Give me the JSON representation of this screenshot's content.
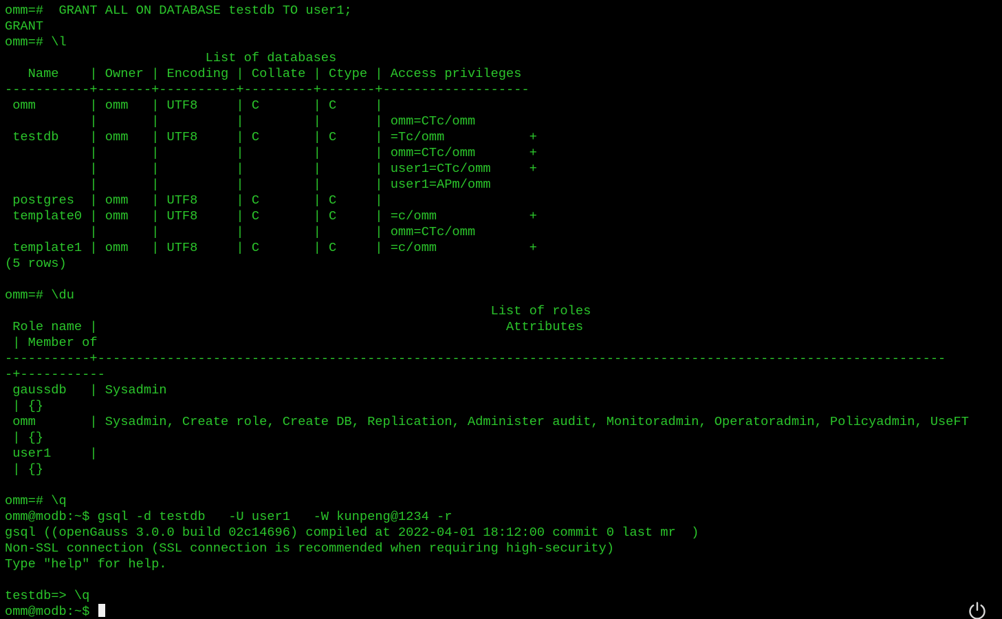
{
  "terminal": {
    "lines": [
      "omm=#  GRANT ALL ON DATABASE testdb TO user1;",
      "GRANT",
      "omm=# \\l",
      "                          List of databases",
      "   Name    | Owner | Encoding | Collate | Ctype | Access privileges",
      "-----------+-------+----------+---------+-------+-------------------",
      " omm       | omm   | UTF8     | C       | C     |",
      "           |       |          |         |       | omm=CTc/omm",
      " testdb    | omm   | UTF8     | C       | C     | =Tc/omm           +",
      "           |       |          |         |       | omm=CTc/omm       +",
      "           |       |          |         |       | user1=CTc/omm     +",
      "           |       |          |         |       | user1=APm/omm",
      " postgres  | omm   | UTF8     | C       | C     |",
      " template0 | omm   | UTF8     | C       | C     | =c/omm            +",
      "           |       |          |         |       | omm=CTc/omm",
      " template1 | omm   | UTF8     | C       | C     | =c/omm            +",
      "(5 rows)",
      "",
      "omm=# \\du",
      "                                                               List of roles",
      " Role name |                                                     Attributes",
      " | Member of",
      "-----------+--------------------------------------------------------------------------------------------------------------",
      "-+-----------",
      " gaussdb   | Sysadmin",
      " | {}",
      " omm       | Sysadmin, Create role, Create DB, Replication, Administer audit, Monitoradmin, Operatoradmin, Policyadmin, UseFT",
      " | {}",
      " user1     |",
      " | {}",
      "",
      "omm=# \\q",
      "omm@modb:~$ gsql -d testdb   -U user1   -W kunpeng@1234 -r",
      "gsql ((openGauss 3.0.0 build 02c14696) compiled at 2022-04-01 18:12:00 commit 0 last mr  )",
      "Non-SSL connection (SSL connection is recommended when requiring high-security)",
      "Type \"help\" for help.",
      "",
      "testdb=> \\q"
    ],
    "prompt": "omm@modb:~$ ",
    "text_color": "#2bc52b",
    "background_color": "#000000",
    "cursor_color": "#f0f0f0"
  },
  "power_button": {
    "icon": "power-icon",
    "color": "#d8d8d8"
  }
}
